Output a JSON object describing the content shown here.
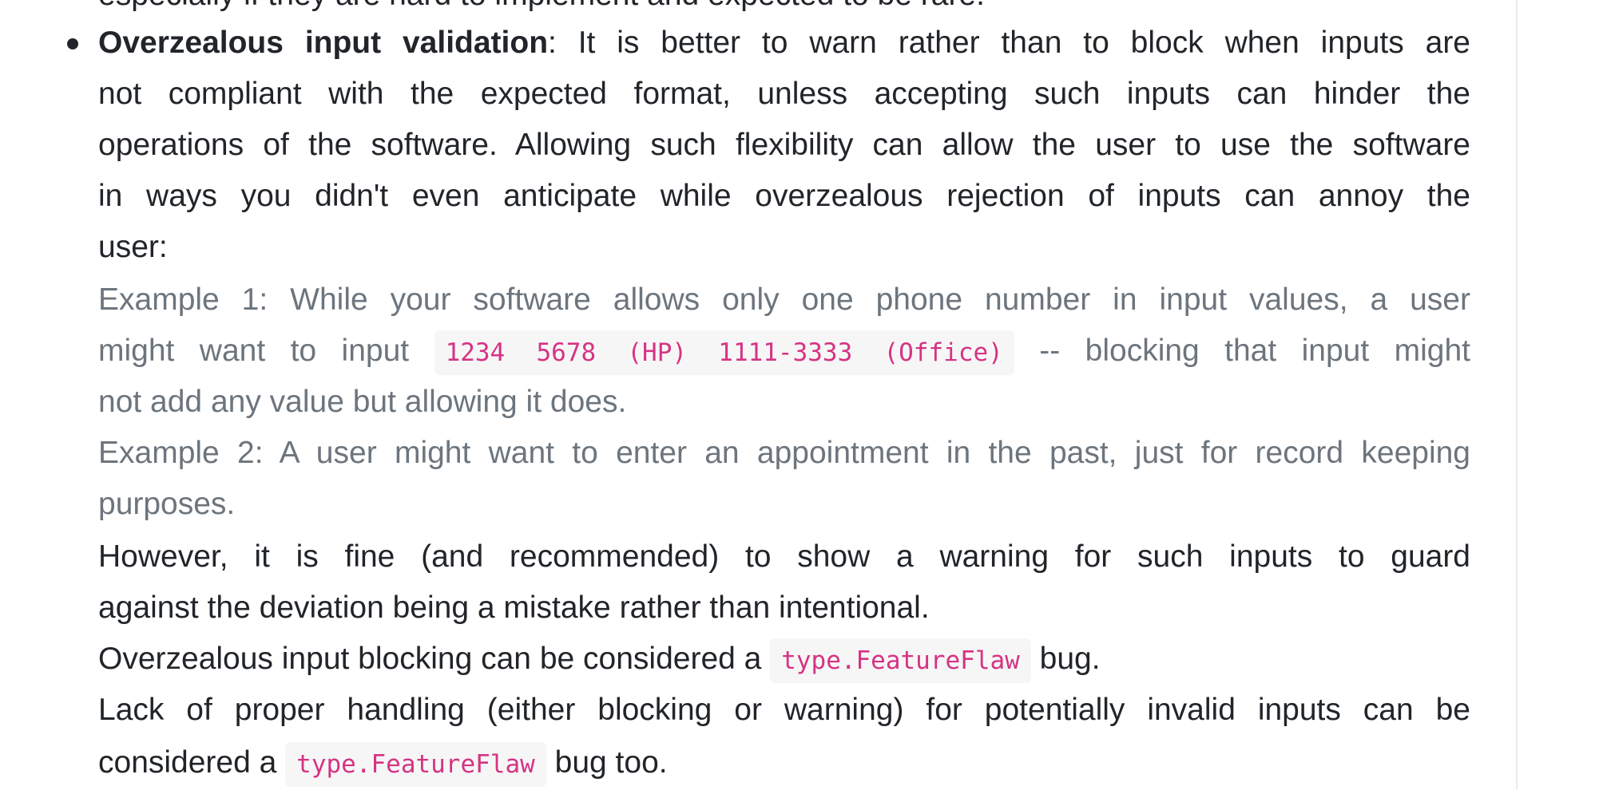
{
  "previous_line": "especially if they are hard to implement and expected to be rare.",
  "item": {
    "title": "Overzealous input validation",
    "lines": [
      ": It is better to warn rather than to block when inputs are",
      "not compliant with the expected format, unless accepting such inputs can hinder the",
      "operations of the software. Allowing such flexibility can allow the user to use the software",
      "in ways you didn't even anticipate while overzealous rejection of inputs can annoy the",
      "user:"
    ],
    "example1": {
      "line1": "Example 1: While your software allows only one phone number in input values, a user",
      "before_code": "might want to input",
      "code": "1234 5678 (HP) 1111-3333 (Office)",
      "after_code": "-- blocking that input might",
      "line3": "not add any value but allowing it does."
    },
    "example2": {
      "line1": "Example 2: A user might want to enter an appointment in the past, just for record keeping",
      "line2": "purposes."
    },
    "however": {
      "line1": "However, it is fine (and recommended) to show a warning for such inputs to guard",
      "line2": "against the deviation being a mistake rather than intentional."
    },
    "blocking": {
      "before": "Overzealous input blocking can be considered a",
      "code": "type.FeatureFlaw",
      "after": "bug."
    },
    "lack": {
      "line1": "Lack of proper handling (either blocking or warning) for potentially invalid inputs can be",
      "before": "considered a",
      "code": "type.FeatureFlaw",
      "after": "bug too."
    }
  },
  "colors": {
    "text": "#212529",
    "example": "#6c757d",
    "code": "#d63384",
    "code_bg": "#f6f6f6"
  }
}
